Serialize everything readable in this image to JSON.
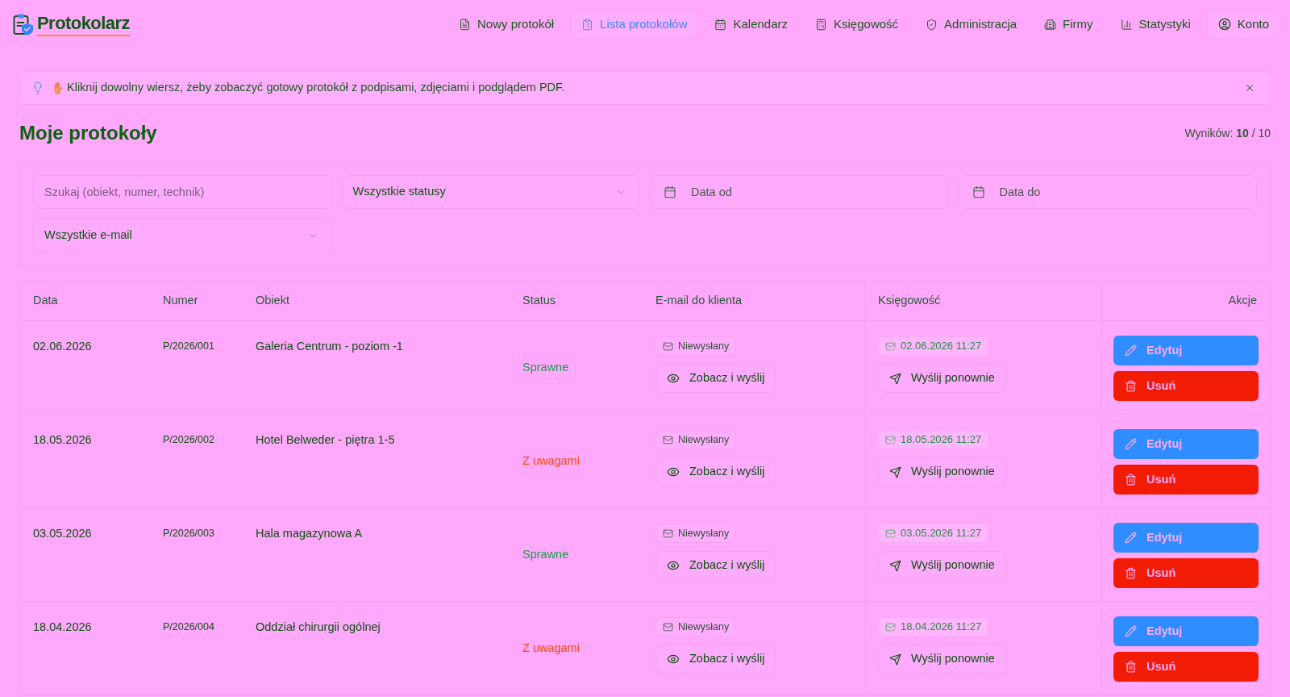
{
  "header": {
    "logo": "Protokolarz",
    "nav": [
      {
        "label": "Nowy protokół",
        "selected": false
      },
      {
        "label": "Lista protokołów",
        "selected": true
      },
      {
        "label": "Kalendarz",
        "selected": false
      },
      {
        "label": "Księgowość",
        "selected": false
      },
      {
        "label": "Administracja",
        "selected": false
      },
      {
        "label": "Firmy",
        "selected": false
      },
      {
        "label": "Statystyki",
        "selected": false
      }
    ],
    "account": "Konto"
  },
  "banner": {
    "text": "Kliknij dowolny wiersz, żeby zobaczyć gotowy protokół z podpisami, zdjęciami i podglądem PDF."
  },
  "page": {
    "title": "Moje protokoły",
    "results": "Wyników: **10** / 10"
  },
  "filters": {
    "search": {
      "placeholder": "Szukaj (obiekt, numer, technik)"
    },
    "status_select": {
      "value": "Wszystkie statusy"
    },
    "date_from": {
      "placeholder": "Data od"
    },
    "date_to": {
      "placeholder": "Data do"
    },
    "email_select": {
      "value": "Wszystkie e-mail"
    }
  },
  "table": {
    "columns": [
      "Data",
      "Numer",
      "Obiekt",
      "Status",
      "E-mail do klienta",
      "Księgowość",
      "Akcje"
    ],
    "rows": [
      {
        "date": "02.06.2026",
        "number": "P/2026/001",
        "site": "Galeria Centrum - poziom -1",
        "status": {
          "label": "Sprawne",
          "color": "#1f9a4c"
        },
        "email_status": "Niewysłany",
        "email_button": "Zobacz i wyślij",
        "accounting_date": "02.06.2026 11:27",
        "accounting_button": "Wyślij ponownie",
        "edit": "Edytuj",
        "delete": "Usuń"
      },
      {
        "date": "18.05.2026",
        "number": "P/2026/002",
        "site": "Hotel Belweder - piętra 1-5",
        "status": {
          "label": "Z uwagami",
          "color": "#f04c10"
        },
        "email_status": "Niewysłany",
        "email_button": "Zobacz i wyślij",
        "accounting_date": "18.05.2026 11:27",
        "accounting_button": "Wyślij ponownie",
        "edit": "Edytuj",
        "delete": "Usuń"
      },
      {
        "date": "03.05.2026",
        "number": "P/2026/003",
        "site": "Hala magazynowa A",
        "status": {
          "label": "Sprawne",
          "color": "#1f9a4c"
        },
        "email_status": "Niewysłany",
        "email_button": "Zobacz i wyślij",
        "accounting_date": "03.05.2026 11:27",
        "accounting_button": "Wyślij ponownie",
        "edit": "Edytuj",
        "delete": "Usuń"
      },
      {
        "date": "18.04.2026",
        "number": "P/2026/004",
        "site": "Oddział chirurgii ogólnej",
        "status": {
          "label": "Z uwagami",
          "color": "#f04c10"
        },
        "email_status": "Niewysłany",
        "email_button": "Zobacz i wyślij",
        "accounting_date": "18.04.2026 11:27",
        "accounting_button": "Wyślij ponownie",
        "edit": "Edytuj",
        "delete": "Usuń"
      }
    ]
  }
}
